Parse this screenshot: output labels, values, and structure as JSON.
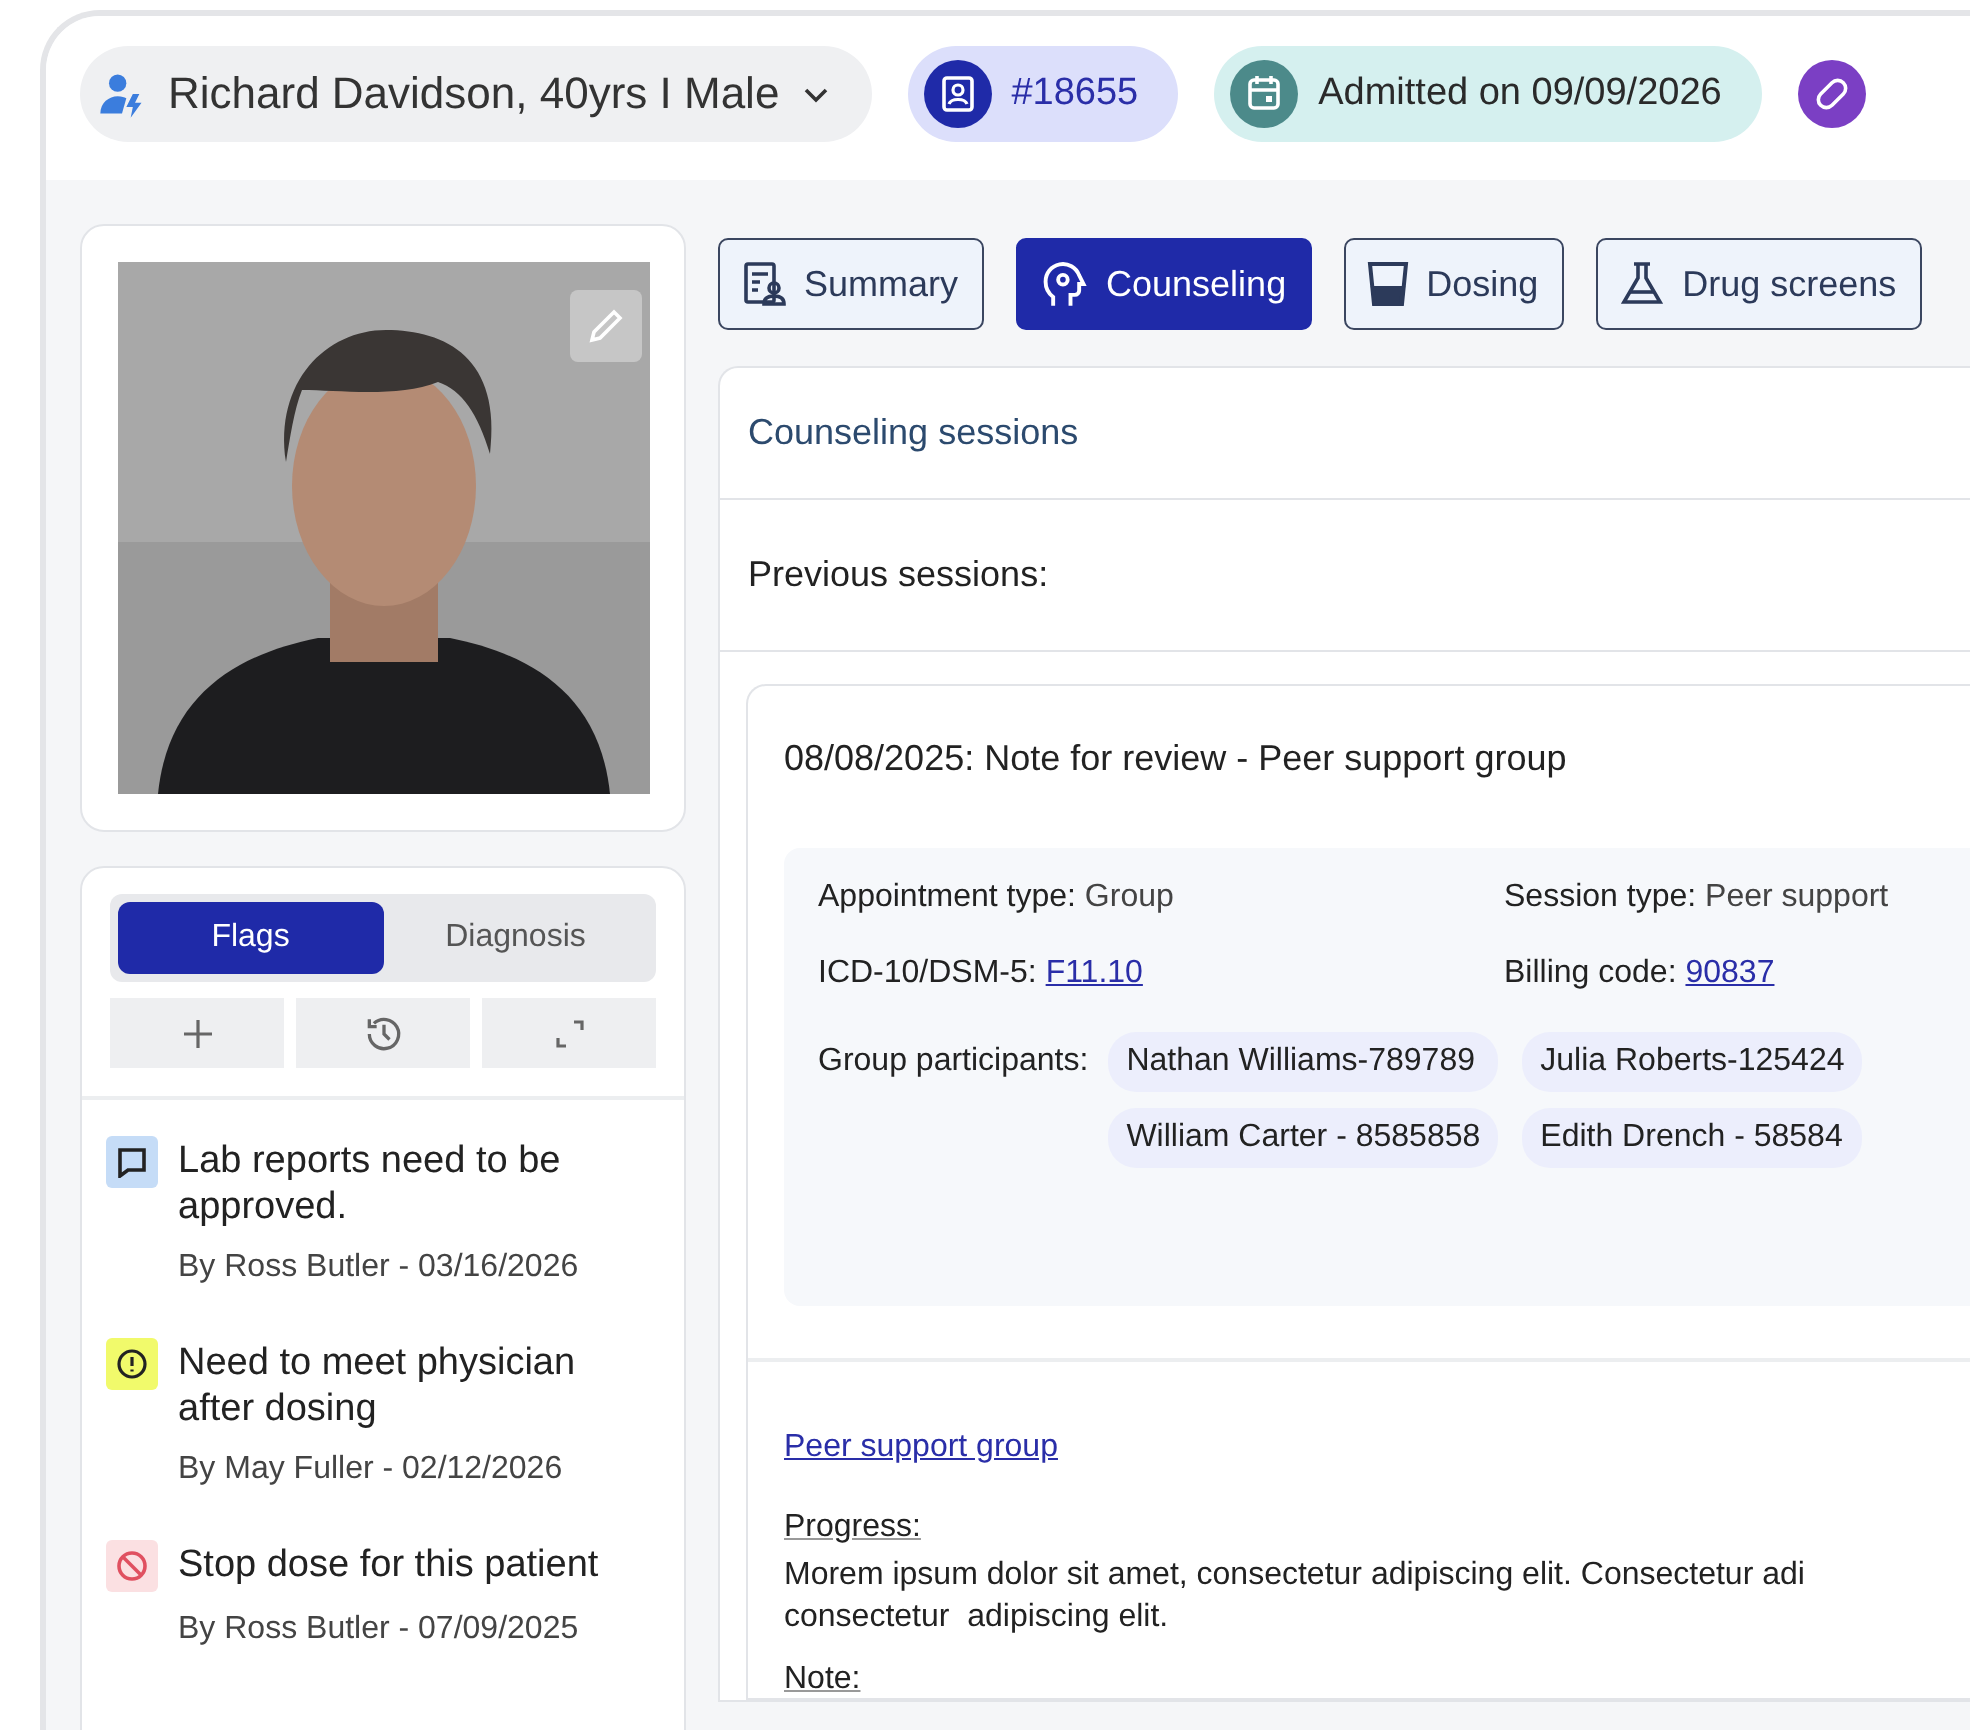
{
  "patient": {
    "name": "Richard Davidson, 40yrs I Male",
    "id": "#18655",
    "admitted": "Admitted on 09/09/2026"
  },
  "side_tabs": [
    {
      "label": "Flags",
      "selected": true
    },
    {
      "label": "Diagnosis",
      "selected": false
    }
  ],
  "flags": [
    {
      "kind": "comment",
      "text": "Lab reports need to be approved.",
      "meta": "By Ross Butler - 03/16/2026"
    },
    {
      "kind": "alert",
      "text": "Need to meet physician after dosing",
      "meta": "By May Fuller - 02/12/2026"
    },
    {
      "kind": "stop",
      "text": "Stop dose for this patient",
      "meta": "By Ross Butler - 07/09/2025"
    }
  ],
  "tabs": [
    {
      "kind": "summary",
      "label": "Summary",
      "selected": false
    },
    {
      "kind": "counseling",
      "label": "Counseling",
      "selected": true
    },
    {
      "kind": "dosing",
      "label": "Dosing",
      "selected": false
    },
    {
      "kind": "screens",
      "label": "Drug screens",
      "selected": false
    }
  ],
  "section_title": "Counseling sessions",
  "previous_label": "Previous sessions:",
  "session": {
    "title": "08/08/2025: Note for review - Peer support group",
    "fields": [
      {
        "kind": "text",
        "label": "Appointment type:",
        "value": "Group"
      },
      {
        "kind": "text",
        "label": "Session type:",
        "value": "Peer support"
      },
      {
        "kind": "link",
        "label": "ICD-10/DSM-5:",
        "value": "F11.10"
      },
      {
        "kind": "link",
        "label": "Billing code:",
        "value": "90837"
      }
    ],
    "participants_label": "Group participants:",
    "participants": [
      "Nathan Williams-789789",
      "Julia Roberts-125424",
      "William Carter - 8585858",
      "Edith Drench - 58584"
    ],
    "link": "Peer support group",
    "progress_label": "Progress:",
    "progress_lines": [
      "Morem ipsum dolor sit amet, consectetur adipiscing elit. Consectetur adi",
      "consectetur  adipiscing elit."
    ],
    "note_label": "Note:"
  }
}
